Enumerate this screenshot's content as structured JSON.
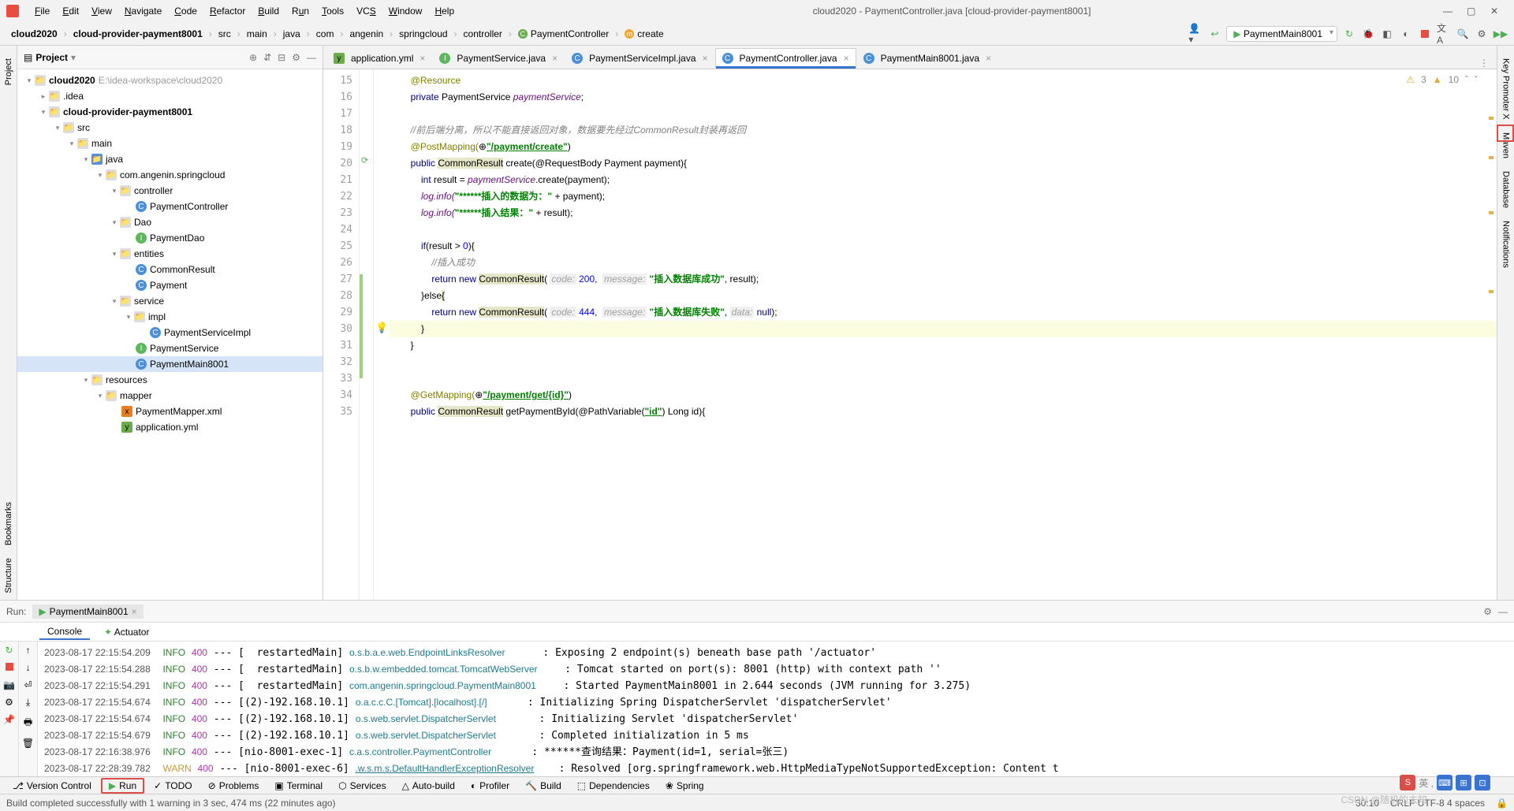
{
  "title": "cloud2020 - PaymentController.java [cloud-provider-payment8001]",
  "menu": [
    "File",
    "Edit",
    "View",
    "Navigate",
    "Code",
    "Refactor",
    "Build",
    "Run",
    "Tools",
    "VCS",
    "Window",
    "Help"
  ],
  "breadcrumbs": [
    "cloud2020",
    "cloud-provider-payment8001",
    "src",
    "main",
    "java",
    "com",
    "angenin",
    "springcloud",
    "controller",
    "PaymentController",
    "create"
  ],
  "runConfig": "PaymentMain8001",
  "projectPanel": {
    "title": "Project"
  },
  "tree": {
    "root": {
      "label": "cloud2020",
      "extra": "E:\\idea-workspace\\cloud2020"
    },
    "idea": ".idea",
    "module": "cloud-provider-payment8001",
    "src": "src",
    "main": "main",
    "java": "java",
    "pkg": "com.angenin.springcloud",
    "controller": "controller",
    "paymentController": "PaymentController",
    "dao": "Dao",
    "paymentDao": "PaymentDao",
    "entities": "entities",
    "commonResult": "CommonResult",
    "payment": "Payment",
    "service": "service",
    "impl": "impl",
    "paymentServiceImpl": "PaymentServiceImpl",
    "paymentService": "PaymentService",
    "paymentMain": "PaymentMain8001",
    "resources": "resources",
    "mapper": "mapper",
    "paymentMapperXml": "PaymentMapper.xml",
    "applicationYml": "application.yml"
  },
  "tabs": [
    {
      "label": "application.yml",
      "icon": "yml"
    },
    {
      "label": "PaymentService.java",
      "icon": "class-i"
    },
    {
      "label": "PaymentServiceImpl.java",
      "icon": "class-c"
    },
    {
      "label": "PaymentController.java",
      "icon": "class-c",
      "active": true
    },
    {
      "label": "PaymentMain8001.java",
      "icon": "class-c"
    }
  ],
  "inspections": {
    "warnings": "3",
    "weak": "10"
  },
  "codeLines": {
    "start": 15,
    "l15": "        @Resource",
    "l16": "        private PaymentService paymentService;",
    "l17": "",
    "l18_cmt": "        //前后端分离，所以不能直接返回对象，数据要先经过CommonResult封装再返回",
    "l19_a": "        @PostMapping(",
    "l19_b": "\"/payment/create\"",
    "l19_c": ")",
    "l20_a": "        public ",
    "l20_b": "CommonResult",
    "l20_c": " create(@RequestBody Payment payment){",
    "l21": "            int result = paymentService.create(payment);",
    "l22_a": "            log.info(",
    "l22_b": "\"******插入的数据为：\"",
    "l22_c": " + payment);",
    "l23_a": "            log.info(",
    "l23_b": "\"******插入结果：\"",
    "l23_c": " + result);",
    "l24": "",
    "l25": "            if(result > 0){",
    "l26_cmt": "                //插入成功",
    "l27_a": "                return new ",
    "l27_b": "CommonResult",
    "l27_c": "( ",
    "l27_h1": "code:",
    "l27_d": " 200,  ",
    "l27_h2": "message:",
    "l27_e": " \"插入数据库成功\", result);",
    "l28_a": "            }else",
    "l28_b": "{",
    "l29_a": "                return new ",
    "l29_b": "CommonResult",
    "l29_c": "( ",
    "l29_h1": "code:",
    "l29_d": " 444,  ",
    "l29_h2": "message:",
    "l29_e": " \"插入数据库失败\", ",
    "l29_h3": "data:",
    "l29_f": " null);",
    "l30": "            }",
    "l31": "        }",
    "l32": "",
    "l33": "",
    "l34_a": "        @GetMapping(",
    "l34_b": "\"/payment/get/{id}\"",
    "l34_c": ")",
    "l35_a": "        public ",
    "l35_b": "CommonResult",
    "l35_c": " getPaymentById(@PathVariable(",
    "l35_d": "\"id\"",
    "l35_e": ") Long id){"
  },
  "runTool": {
    "label": "Run:",
    "tab": "PaymentMain8001",
    "subtabs": [
      "Console",
      "Actuator"
    ]
  },
  "consoleLines": [
    {
      "ts": "2023-08-17 22:15:54.209",
      "lvl": "INFO",
      "code": "400",
      "thread": "[  restartedMain]",
      "logger": "o.s.b.a.e.web.EndpointLinksResolver",
      "msg": ": Exposing 2 endpoint(s) beneath base path '/actuator'"
    },
    {
      "ts": "2023-08-17 22:15:54.288",
      "lvl": "INFO",
      "code": "400",
      "thread": "[  restartedMain]",
      "logger": "o.s.b.w.embedded.tomcat.TomcatWebServer",
      "msg": ": Tomcat started on port(s): 8001 (http) with context path ''"
    },
    {
      "ts": "2023-08-17 22:15:54.291",
      "lvl": "INFO",
      "code": "400",
      "thread": "[  restartedMain]",
      "logger": "com.angenin.springcloud.PaymentMain8001",
      "msg": ": Started PaymentMain8001 in 2.644 seconds (JVM running for 3.275)"
    },
    {
      "ts": "2023-08-17 22:15:54.674",
      "lvl": "INFO",
      "code": "400",
      "thread": "[(2)-192.168.10.1]",
      "logger": "o.a.c.c.C.[Tomcat].[localhost].[/]",
      "msg": ": Initializing Spring DispatcherServlet 'dispatcherServlet'"
    },
    {
      "ts": "2023-08-17 22:15:54.674",
      "lvl": "INFO",
      "code": "400",
      "thread": "[(2)-192.168.10.1]",
      "logger": "o.s.web.servlet.DispatcherServlet",
      "msg": ": Initializing Servlet 'dispatcherServlet'"
    },
    {
      "ts": "2023-08-17 22:15:54.679",
      "lvl": "INFO",
      "code": "400",
      "thread": "[(2)-192.168.10.1]",
      "logger": "o.s.web.servlet.DispatcherServlet",
      "msg": ": Completed initialization in 5 ms"
    },
    {
      "ts": "2023-08-17 22:16:38.976",
      "lvl": "INFO",
      "code": "400",
      "thread": "[nio-8001-exec-1]",
      "logger": "c.a.s.controller.PaymentController",
      "msg": ": ******查询结果：Payment(id=1, serial=张三)"
    },
    {
      "ts": "2023-08-17 22:28:39.782",
      "lvl": "WARN",
      "code": "400",
      "thread": "[nio-8001-exec-6]",
      "logger": ".w.s.m.s.DefaultHandlerExceptionResolver",
      "msg": ": Resolved [org.springframework.web.HttpMediaTypeNotSupportedException: Content t"
    }
  ],
  "bottomTabs": [
    "Version Control",
    "Run",
    "TODO",
    "Problems",
    "Terminal",
    "Services",
    "Auto-build",
    "Profiler",
    "Build",
    "Dependencies",
    "Spring"
  ],
  "statusMsg": "Build completed successfully with 1 warning in 3 sec, 474 ms (22 minutes ago)",
  "statusRight": {
    "pos": "30:10",
    "enc": "CRLF  UTF-8  4 spaces"
  },
  "watermark": "CSDN @随机的未知",
  "sideLeft": [
    "Project",
    "Bookmarks",
    "Structure"
  ],
  "sideRight": [
    "Key Promoter X",
    "Maven",
    "Database",
    "Notifications"
  ]
}
